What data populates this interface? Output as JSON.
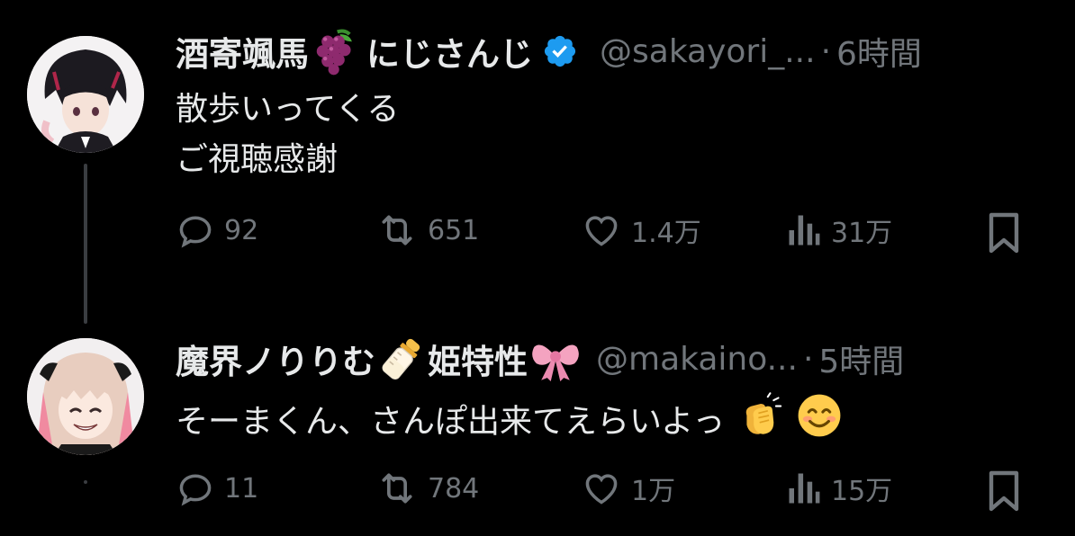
{
  "tweets": [
    {
      "display_name": "酒寄颯馬",
      "name_emoji": "grapes-emoji",
      "name_suffix": "にじさんじ",
      "verified": true,
      "handle": "@sakayori_...",
      "separator": "·",
      "time": "6時間",
      "lines": [
        "散歩いってくる",
        "ご視聴感謝"
      ],
      "actions": {
        "replies": "92",
        "reposts": "651",
        "likes": "1.4万",
        "views": "31万"
      }
    },
    {
      "display_name": "魔界ノりりむ",
      "name_emoji": "baby-bottle-emoji",
      "name_suffix": "姫特性",
      "name_emoji_2": "ribbon-emoji",
      "verified": false,
      "handle": "@makaino...",
      "separator": "·",
      "time": "5時間",
      "lines": [
        "そーまくん、さんぽ出来てえらいよっ"
      ],
      "text_emojis": [
        "clapping-hands-emoji",
        "smiling-face-emoji"
      ],
      "actions": {
        "replies": "11",
        "reposts": "784",
        "likes": "1万",
        "views": "15万"
      }
    }
  ],
  "colors": {
    "background": "#000000",
    "text": "#e7e9ea",
    "muted": "#71767b",
    "verified": "#1d9bf0",
    "thread_line": "#3a3d41"
  }
}
